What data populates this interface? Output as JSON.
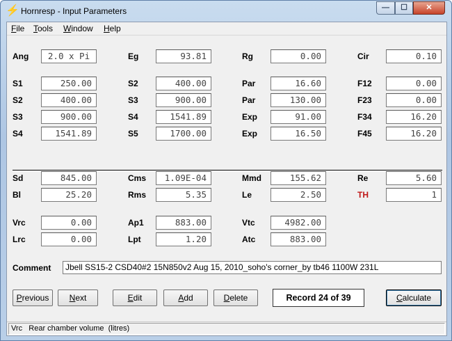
{
  "window": {
    "title": "Hornresp - Input Parameters",
    "controls": {
      "minimize": "—",
      "maximize": "☐",
      "close": "✕"
    }
  },
  "menu": {
    "items": [
      {
        "underline": "F",
        "rest": "ile"
      },
      {
        "underline": "T",
        "rest": "ools"
      },
      {
        "underline": "W",
        "rest": "indow"
      },
      {
        "underline": "H",
        "rest": "elp"
      }
    ]
  },
  "params": {
    "ang": {
      "label": "Ang",
      "value": "2.0 x Pi"
    },
    "eg": {
      "label": "Eg",
      "value": "93.81"
    },
    "rg": {
      "label": "Rg",
      "value": "0.00"
    },
    "cir": {
      "label": "Cir",
      "value": "0.10"
    },
    "s1": {
      "label": "S1",
      "value": "250.00"
    },
    "s2a": {
      "label": "S2",
      "value": "400.00"
    },
    "par1": {
      "label": "Par",
      "value": "16.60"
    },
    "f12": {
      "label": "F12",
      "value": "0.00"
    },
    "s2b": {
      "label": "S2",
      "value": "400.00"
    },
    "s3a": {
      "label": "S3",
      "value": "900.00"
    },
    "par2": {
      "label": "Par",
      "value": "130.00"
    },
    "f23": {
      "label": "F23",
      "value": "0.00"
    },
    "s3b": {
      "label": "S3",
      "value": "900.00"
    },
    "s4a": {
      "label": "S4",
      "value": "1541.89"
    },
    "exp1": {
      "label": "Exp",
      "value": "91.00"
    },
    "f34": {
      "label": "F34",
      "value": "16.20"
    },
    "s4b": {
      "label": "S4",
      "value": "1541.89"
    },
    "s5": {
      "label": "S5",
      "value": "1700.00"
    },
    "exp2": {
      "label": "Exp",
      "value": "16.50"
    },
    "f45": {
      "label": "F45",
      "value": "16.20"
    },
    "sd": {
      "label": "Sd",
      "value": "845.00"
    },
    "cms": {
      "label": "Cms",
      "value": "1.09E-04"
    },
    "mmd": {
      "label": "Mmd",
      "value": "155.62"
    },
    "re": {
      "label": "Re",
      "value": "5.60"
    },
    "bl": {
      "label": "Bl",
      "value": "25.20"
    },
    "rms": {
      "label": "Rms",
      "value": "5.35"
    },
    "le": {
      "label": "Le",
      "value": "2.50"
    },
    "th": {
      "label": "TH",
      "value": "1"
    },
    "vrc": {
      "label": "Vrc",
      "value": "0.00"
    },
    "ap1": {
      "label": "Ap1",
      "value": "883.00"
    },
    "vtc": {
      "label": "Vtc",
      "value": "4982.00"
    },
    "lrc": {
      "label": "Lrc",
      "value": "0.00"
    },
    "lpt": {
      "label": "Lpt",
      "value": "1.20"
    },
    "atc": {
      "label": "Atc",
      "value": "883.00"
    }
  },
  "comment": {
    "label": "Comment",
    "value": "Jbell SS15-2 CSD40#2 15N850v2 Aug 15, 2010_soho's corner_by tb46 1100W 231L"
  },
  "buttons": {
    "previous": {
      "underline": "P",
      "rest": "revious"
    },
    "next": {
      "underline": "N",
      "rest": "ext"
    },
    "edit": {
      "underline": "E",
      "rest": "dit"
    },
    "add": {
      "underline": "A",
      "rest": "dd"
    },
    "delete": {
      "underline": "D",
      "rest": "elete"
    },
    "calculate": {
      "underline": "C",
      "rest": "alculate"
    }
  },
  "record": "Record 24 of 39",
  "status": "Vrc   Rear chamber volume  (litres)",
  "colors": {
    "th_label": "#c01818"
  }
}
